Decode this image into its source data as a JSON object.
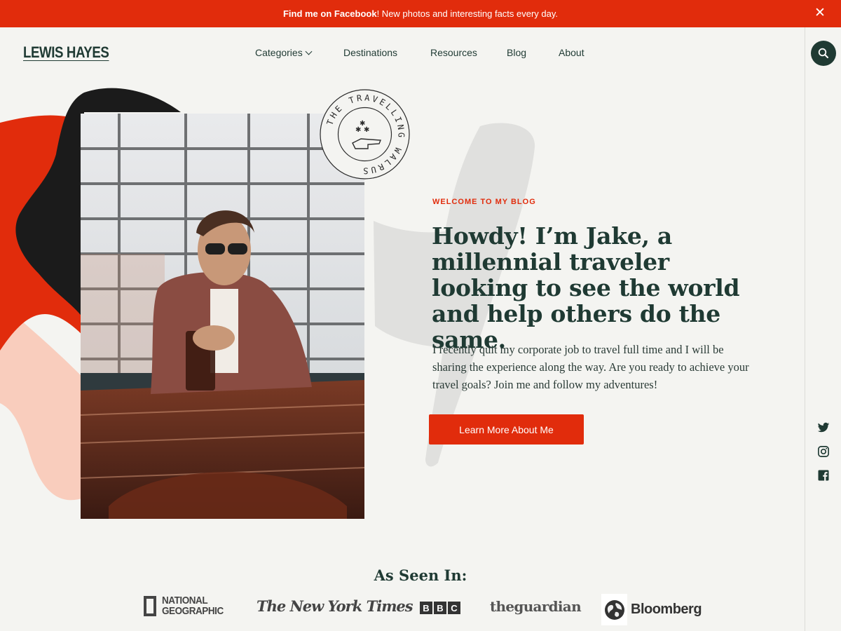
{
  "announcement": {
    "link_text": "Find me on Facebook",
    "rest_text": "! New photos and interesting facts every day.",
    "close_icon": "close-icon"
  },
  "header": {
    "logo": "LEWIS HAYES",
    "nav": [
      "Categories",
      "Destinations",
      "Resources",
      "Blog",
      "About"
    ],
    "search_icon": "search-icon"
  },
  "stamp": {
    "text": "THE TRAVELLING WALRUS"
  },
  "hero": {
    "eyebrow": "WELCOME TO MY BLOG",
    "headline": "Howdy! I’m Jake, a millennial traveler looking to see the world and help others do the same.",
    "intro": "I recently quit my corporate job to travel full time and I will be sharing the experience along the way. Are you ready to achieve your travel goals?  Join me and follow my adventures!",
    "cta": "Learn More About Me"
  },
  "social": [
    "twitter-icon",
    "instagram-icon",
    "facebook-icon"
  ],
  "press": {
    "title": "As Seen In:",
    "natgeo_line1": "NATIONAL",
    "natgeo_line2": "GEOGRAPHIC",
    "nyt": "The New York Times",
    "bbc": [
      "B",
      "B",
      "C"
    ],
    "guardian": "theguardian",
    "bloomberg": "Bloomberg"
  },
  "colors": {
    "accent": "#e12c0c",
    "dark": "#1f3a33",
    "background": "#f4f4f1",
    "blush": "#f9cdbd"
  }
}
